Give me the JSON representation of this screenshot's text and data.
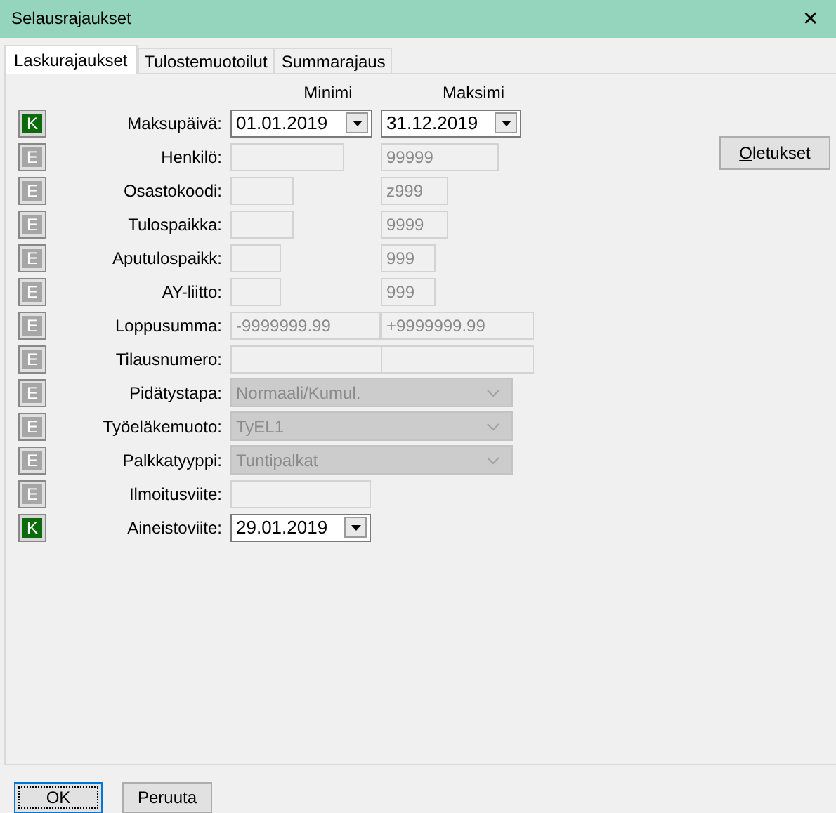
{
  "window": {
    "title": "Selausrajaukset",
    "close": "✕"
  },
  "tabs": [
    {
      "label": "Laskurajaukset",
      "selected": true
    },
    {
      "label": "Tulostemuotoilut",
      "selected": false
    },
    {
      "label": "Summarajaus",
      "selected": false
    }
  ],
  "columns": {
    "min": "Minimi",
    "max": "Maksimi"
  },
  "rows": [
    {
      "kind": "range",
      "toggle": "K",
      "on": true,
      "label": "Maksupäivä:",
      "min": {
        "kind": "date",
        "value": "01.01.2019",
        "disabled": false
      },
      "max": {
        "kind": "date",
        "value": "31.12.2019",
        "disabled": false
      }
    },
    {
      "kind": "range",
      "toggle": "E",
      "on": false,
      "label": "Henkilö:",
      "min": {
        "kind": "text",
        "disabled": true
      },
      "max": {
        "kind": "text",
        "value": "99999",
        "disabled": true
      }
    },
    {
      "kind": "range",
      "toggle": "E",
      "on": false,
      "label": "Osastokoodi:",
      "min": {
        "kind": "text",
        "disabled": true
      },
      "max": {
        "kind": "text",
        "value": "z999",
        "disabled": true
      }
    },
    {
      "kind": "range",
      "toggle": "E",
      "on": false,
      "label": "Tulospaikka:",
      "min": {
        "kind": "text",
        "disabled": true
      },
      "max": {
        "kind": "text",
        "value": "9999",
        "disabled": true
      }
    },
    {
      "kind": "range",
      "toggle": "E",
      "on": false,
      "label": "Aputulospaikk:",
      "min": {
        "kind": "text",
        "disabled": true
      },
      "max": {
        "kind": "text",
        "value": "999",
        "disabled": true
      }
    },
    {
      "kind": "range",
      "toggle": "E",
      "on": false,
      "label": "AY-liitto:",
      "min": {
        "kind": "text",
        "disabled": true
      },
      "max": {
        "kind": "text",
        "value": "999",
        "disabled": true
      }
    },
    {
      "kind": "range",
      "toggle": "E",
      "on": false,
      "label": "Loppusumma:",
      "min": {
        "kind": "text",
        "value": "-9999999.99",
        "disabled": true
      },
      "max": {
        "kind": "text",
        "value": "+9999999.99",
        "disabled": true
      }
    },
    {
      "kind": "range",
      "toggle": "E",
      "on": false,
      "label": "Tilausnumero:",
      "min": {
        "kind": "text",
        "disabled": true
      },
      "max": {
        "kind": "text",
        "disabled": true
      }
    },
    {
      "kind": "combo",
      "toggle": "E",
      "on": false,
      "label": "Pidätystapa:",
      "value": "Normaali/Kumul.",
      "disabled": true
    },
    {
      "kind": "combo",
      "toggle": "E",
      "on": false,
      "label": "Työeläkemuoto:",
      "value": "TyEL1",
      "disabled": true
    },
    {
      "kind": "combo",
      "toggle": "E",
      "on": false,
      "label": "Palkkatyyppi:",
      "value": "Tuntipalkat",
      "disabled": true
    },
    {
      "kind": "single",
      "toggle": "E",
      "on": false,
      "label": "Ilmoitusviite:",
      "field": {
        "kind": "text",
        "disabled": true
      }
    },
    {
      "kind": "single",
      "toggle": "K",
      "on": true,
      "label": "Aineistoviite:",
      "field": {
        "kind": "date",
        "value": "29.01.2019",
        "disabled": false
      }
    }
  ],
  "defaults_button": "Oletukset",
  "buttons": [
    {
      "label": "OK",
      "focused": true
    },
    {
      "label": "Peruuta",
      "focused": false
    }
  ]
}
